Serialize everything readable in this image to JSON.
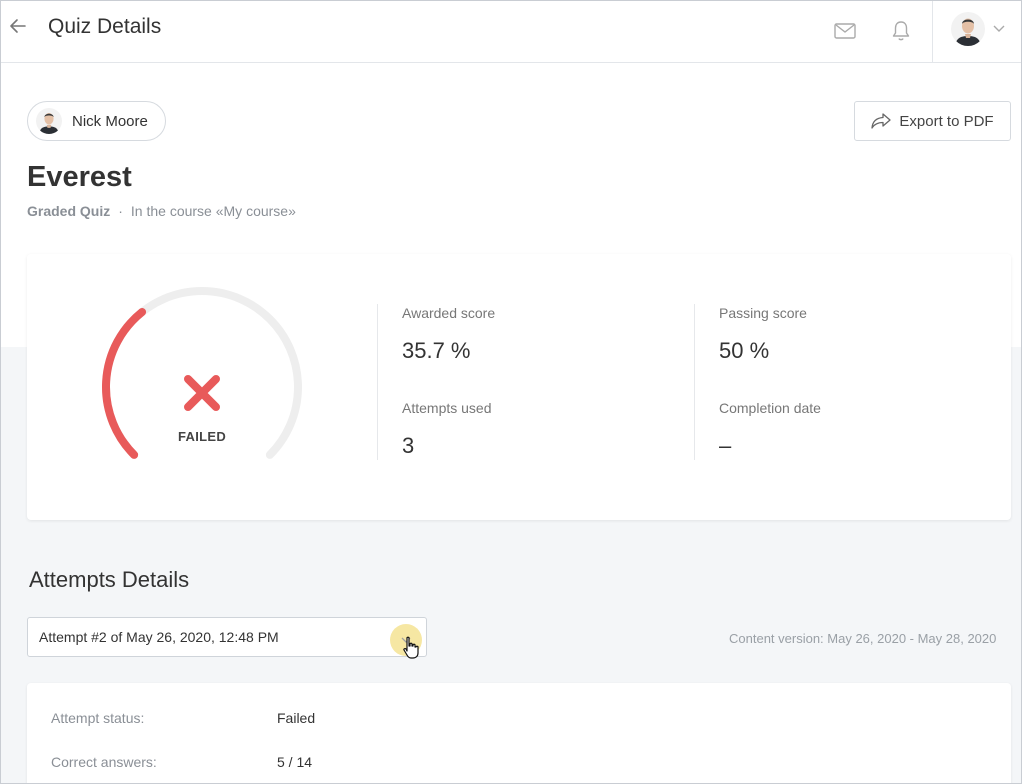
{
  "header": {
    "title": "Quiz Details",
    "icons": {
      "back": "arrow-left-icon",
      "mail": "mail-icon",
      "bell": "bell-icon",
      "chevron": "chevron-down-icon"
    }
  },
  "user": {
    "name": "Nick Moore"
  },
  "export": {
    "label": "Export to PDF",
    "icon": "share-arrow-icon"
  },
  "quiz": {
    "title": "Everest",
    "type": "Graded Quiz",
    "separator": "·",
    "course": "In the course «My course»"
  },
  "result": {
    "status": "FAILED",
    "status_icon": "x-icon",
    "progress_fraction": 0.357,
    "stats": [
      {
        "label": "Awarded score",
        "value": "35.7 %"
      },
      {
        "label": "Passing score",
        "value": "50 %"
      },
      {
        "label": "Attempts used",
        "value": "3"
      },
      {
        "label": "Completion date",
        "value": "–"
      }
    ]
  },
  "attempts": {
    "title": "Attempts Details",
    "selected": "Attempt #2 of May 26, 2020, 12:48 PM",
    "content_version": "Content version: May 26, 2020 - May 28, 2020",
    "details": [
      {
        "label": "Attempt status:",
        "value": "Failed"
      },
      {
        "label": "Correct answers:",
        "value": "5 / 14"
      }
    ]
  },
  "colors": {
    "fail": "#e85a5a",
    "track": "#eeeeee",
    "highlight": "#f6e59a"
  }
}
